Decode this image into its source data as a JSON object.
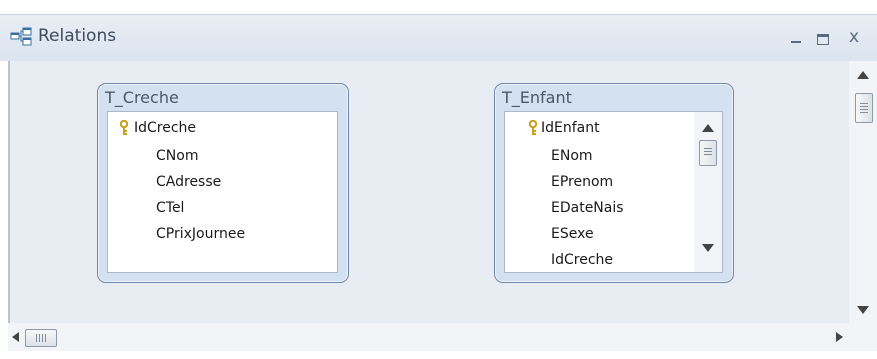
{
  "window": {
    "title": "Relations",
    "icon": "relations-icon",
    "buttons": {
      "minimize": "minimize-icon",
      "maximize": "maximize-icon",
      "close": "x"
    }
  },
  "tables": [
    {
      "name": "T_Creche",
      "fields": [
        {
          "label": "IdCreche",
          "primary_key": true
        },
        {
          "label": "CNom",
          "primary_key": false
        },
        {
          "label": "CAdresse",
          "primary_key": false
        },
        {
          "label": "CTel",
          "primary_key": false
        },
        {
          "label": "CPrixJournee",
          "primary_key": false
        }
      ]
    },
    {
      "name": "T_Enfant",
      "fields": [
        {
          "label": "IdEnfant",
          "primary_key": true
        },
        {
          "label": "ENom",
          "primary_key": false
        },
        {
          "label": "EPrenom",
          "primary_key": false
        },
        {
          "label": "EDateNais",
          "primary_key": false
        },
        {
          "label": "ESexe",
          "primary_key": false
        },
        {
          "label": "IdCreche",
          "primary_key": false
        }
      ]
    }
  ],
  "colors": {
    "canvas_bg": "#e8edf3",
    "table_header_bg": "#d4e1f1",
    "table_border": "#6f88a8",
    "key_icon": "#c8a020"
  }
}
